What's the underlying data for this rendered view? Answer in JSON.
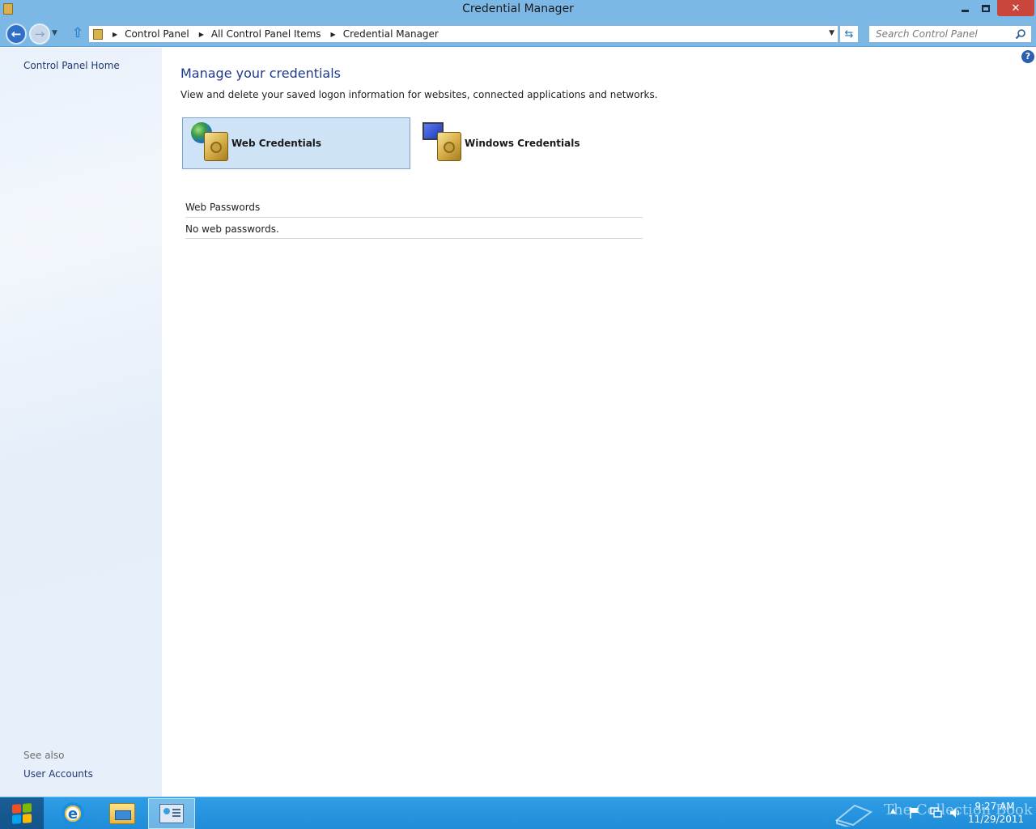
{
  "window": {
    "title": "Credential Manager"
  },
  "nav": {
    "breadcrumbs": [
      "Control Panel",
      "All Control Panel Items",
      "Credential Manager"
    ],
    "search_placeholder": "Search Control Panel"
  },
  "sidebar": {
    "home_link": "Control Panel Home",
    "see_also_label": "See also",
    "see_also_links": [
      "User Accounts"
    ]
  },
  "main": {
    "title": "Manage your credentials",
    "description": "View and delete your saved logon information for websites, connected applications and networks.",
    "tiles": [
      {
        "label": "Web Credentials",
        "icon": "web-credentials-icon",
        "selected": true
      },
      {
        "label": "Windows Credentials",
        "icon": "windows-credentials-icon",
        "selected": false
      }
    ],
    "list": {
      "header": "Web Passwords",
      "empty_text": "No web passwords."
    }
  },
  "taskbar": {
    "apps": [
      "internet-explorer-icon",
      "file-explorer-icon",
      "control-panel-icon"
    ],
    "clock_time": "9:27 AM",
    "clock_date": "11/29/2011",
    "watermark": "The Collection Book"
  },
  "colors": {
    "titlebar": "#7cb8e6",
    "link": "#1e3a6d",
    "page_title": "#1e3a8a",
    "selected_tile": "#cfe3f7",
    "taskbar": "#1e8cd8",
    "close_button": "#c9463d"
  }
}
